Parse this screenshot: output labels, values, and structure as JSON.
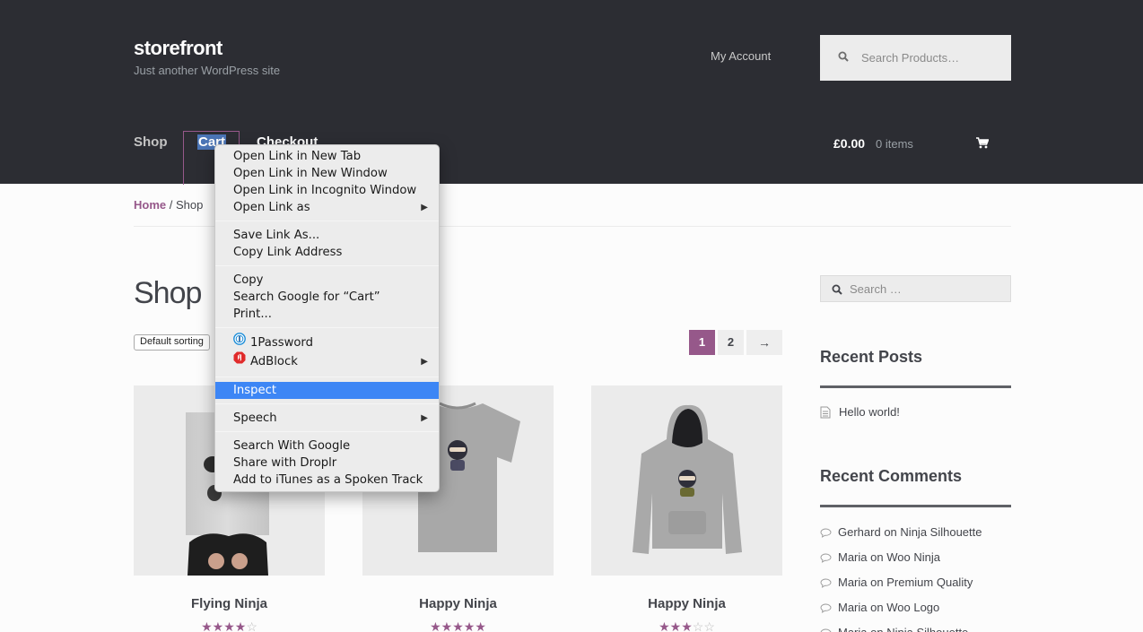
{
  "header": {
    "site_title": "storefront",
    "site_description": "Just another WordPress site",
    "my_account": "My Account",
    "search_placeholder": "Search Products…"
  },
  "nav": {
    "shop": "Shop",
    "cart": "Cart",
    "checkout": "Checkout",
    "cart_total": "£0.00",
    "cart_items": "0 items"
  },
  "breadcrumb": {
    "home": "Home",
    "separator": " / ",
    "current": "Shop"
  },
  "main": {
    "title": "Shop",
    "sorting": "Default sorting",
    "pagination": [
      "1",
      "2",
      "→"
    ],
    "products": [
      {
        "name": "Flying Ninja",
        "rating": 4
      },
      {
        "name": "Happy Ninja",
        "rating": 5
      },
      {
        "name": "Happy Ninja",
        "rating": 3
      }
    ]
  },
  "sidebar": {
    "search_placeholder": "Search …",
    "recent_posts_title": "Recent Posts",
    "recent_posts": [
      "Hello world!"
    ],
    "recent_comments_title": "Recent Comments",
    "recent_comments": [
      {
        "author": "Gerhard",
        "on": "on",
        "post": "Ninja Silhouette"
      },
      {
        "author": "Maria",
        "on": "on",
        "post": "Woo Ninja"
      },
      {
        "author": "Maria",
        "on": "on",
        "post": "Premium Quality"
      },
      {
        "author": "Maria",
        "on": "on",
        "post": "Woo Logo"
      },
      {
        "author": "Maria",
        "on": "on",
        "post": "Ninja Silhouette"
      }
    ]
  },
  "context_menu": {
    "open_new_tab": "Open Link in New Tab",
    "open_new_window": "Open Link in New Window",
    "open_incognito": "Open Link in Incognito Window",
    "open_link_as": "Open Link as",
    "save_link_as": "Save Link As...",
    "copy_link_address": "Copy Link Address",
    "copy": "Copy",
    "search_google_for": "Search Google for “Cart”",
    "print": "Print...",
    "onepassword": "1Password",
    "adblock": "AdBlock",
    "inspect": "Inspect",
    "speech": "Speech",
    "search_with_google": "Search With Google",
    "share_droplr": "Share with Droplr",
    "add_itunes": "Add to iTunes as a Spoken Track"
  },
  "colors": {
    "header_bg": "#2c2d33",
    "accent": "#96588a",
    "menu_highlight": "#3d86f5"
  }
}
